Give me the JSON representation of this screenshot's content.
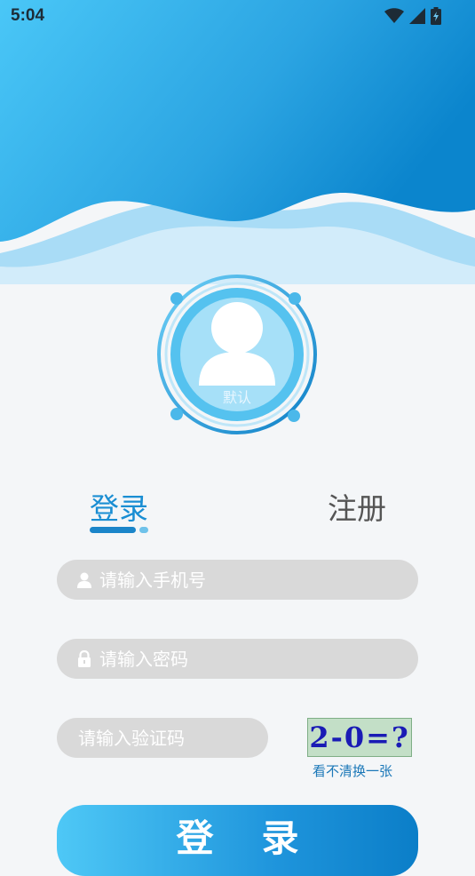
{
  "status_bar": {
    "time": "5:04"
  },
  "avatar": {
    "label": "默认"
  },
  "tabs": [
    {
      "label": "登录",
      "active": true
    },
    {
      "label": "注册",
      "active": false
    }
  ],
  "form": {
    "phone": {
      "placeholder": "请输入手机号",
      "value": ""
    },
    "password": {
      "placeholder": "请输入密码",
      "value": ""
    },
    "captcha": {
      "placeholder": "请输入验证码",
      "value": ""
    },
    "captcha_image_text": "2-0=?",
    "captcha_refresh": "看不清换一张"
  },
  "submit": {
    "label": "登录"
  },
  "colors": {
    "primary": "#1a8ed3",
    "header_gradient_start": "#48c6f7",
    "header_gradient_end": "#0a86cf",
    "field_bg": "#d9d9d9"
  },
  "icons": [
    "wifi-icon",
    "cellular-signal-icon",
    "battery-charging-icon",
    "user-icon",
    "lock-icon"
  ]
}
